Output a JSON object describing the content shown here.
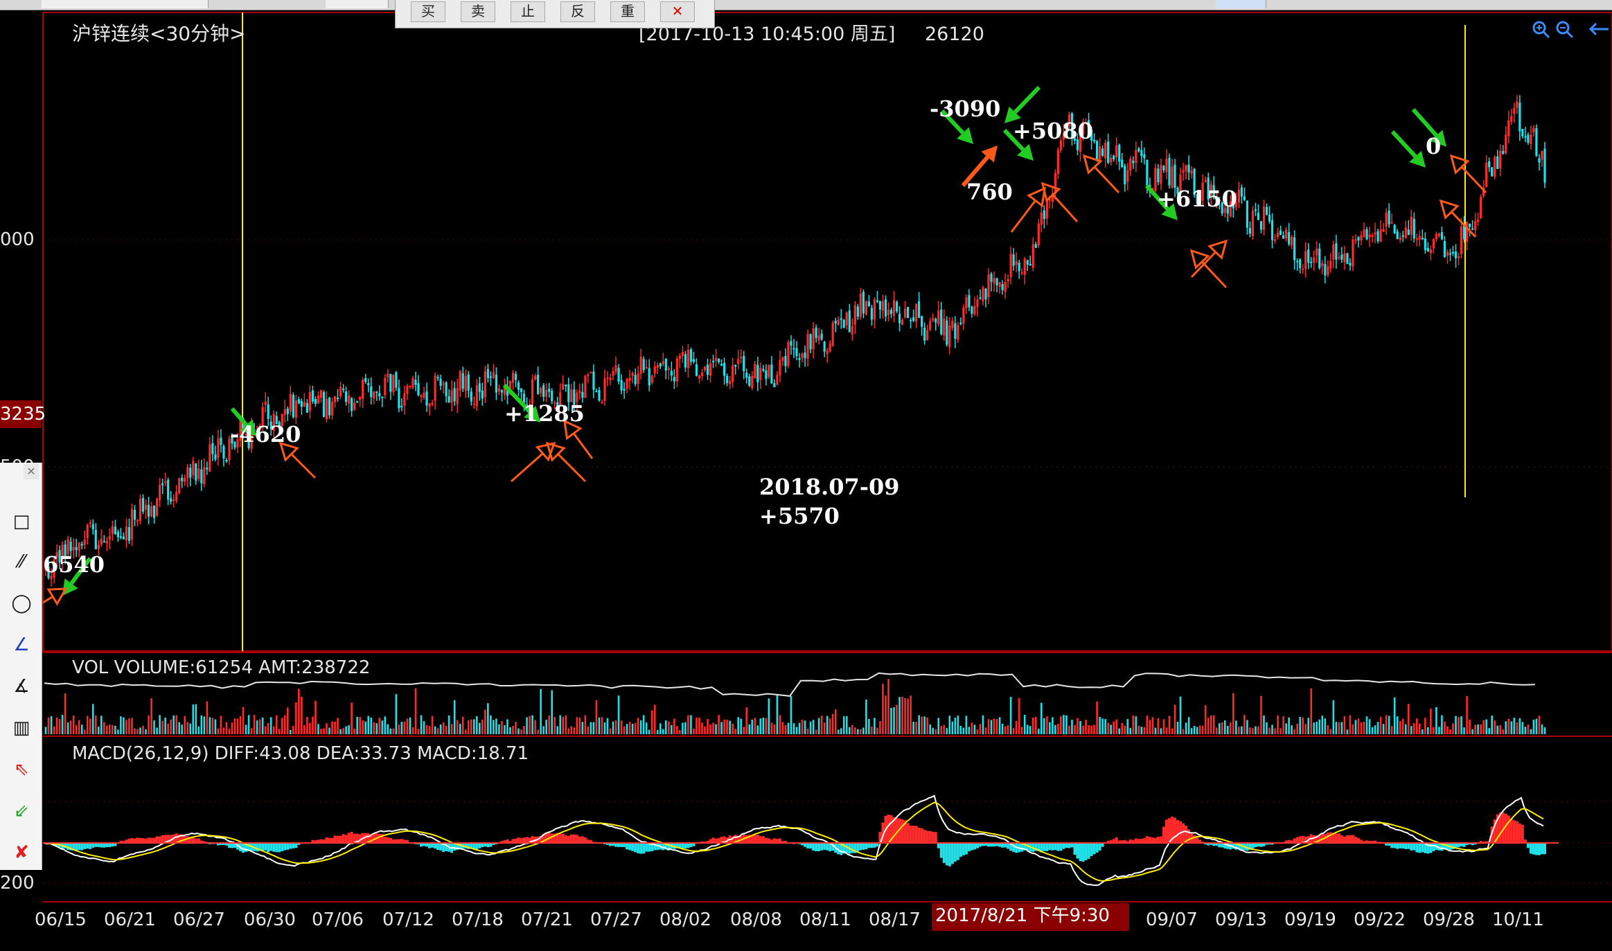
{
  "header": {
    "symbol": "沪锌连续<30分钟>",
    "datetime": "[2017-10-13  10:45:00 周五]",
    "price": "26120"
  },
  "yaxis": {
    "label_000": "000",
    "current_price": "3235",
    "label_500": "500",
    "label_200": "200"
  },
  "vol_label": "VOL  VOLUME:61254 AMT:238722",
  "macd_label": "MACD(26,12,9)  DIFF:43.08 DEA:33.73 MACD:18.71",
  "xaxis": {
    "ticks": [
      "06/15",
      "06/21",
      "06/27",
      "06/30",
      "07/06",
      "07/12",
      "07/18",
      "07/21",
      "07/27",
      "08/02",
      "08/08",
      "08/11",
      "08/17",
      "09/07",
      "09/13",
      "09/19",
      "09/22",
      "09/28",
      "10/11"
    ],
    "cursor_label": "2017/8/21 下午9:30"
  },
  "annotations": {
    "a1": "6540",
    "a2": "-4620",
    "a3": "+1285",
    "a4": "2018.07-09",
    "a5": "+5570",
    "a6": "-3090",
    "a7": "+5080",
    "a8": "760",
    "a9": "+6150",
    "a10": "0"
  },
  "toolbar": [
    "买",
    "卖",
    "止",
    "反",
    "重"
  ],
  "side_tools": [
    "rectangle-tool",
    "line-tool",
    "ellipse-tool",
    "pen-tool",
    "fib-tool",
    "measure-tool",
    "buy-arrow-tool",
    "sell-arrow-tool",
    "delete-tool"
  ],
  "colors": {
    "up": "#ff2a2a",
    "down": "#22e0e8",
    "vline": "#ffee00",
    "panel_border": "#aa0000",
    "green_arrow": "#22cc22",
    "orange_arrow": "#ff5a1a"
  },
  "chart_data": {
    "type": "candlestick",
    "interval": "30分钟",
    "shape": [
      [
        0,
        0.9
      ],
      [
        0.05,
        0.84
      ],
      [
        0.1,
        0.73
      ],
      [
        0.14,
        0.65
      ],
      [
        0.2,
        0.59
      ],
      [
        0.3,
        0.58
      ],
      [
        0.35,
        0.6
      ],
      [
        0.43,
        0.53
      ],
      [
        0.48,
        0.56
      ],
      [
        0.55,
        0.43
      ],
      [
        0.6,
        0.48
      ],
      [
        0.66,
        0.33
      ],
      [
        0.68,
        0.1
      ],
      [
        0.72,
        0.18
      ],
      [
        0.75,
        0.19
      ],
      [
        0.8,
        0.26
      ],
      [
        0.85,
        0.36
      ],
      [
        0.9,
        0.28
      ],
      [
        0.94,
        0.35
      ],
      [
        0.98,
        0.07
      ],
      [
        1.0,
        0.18
      ]
    ]
  }
}
